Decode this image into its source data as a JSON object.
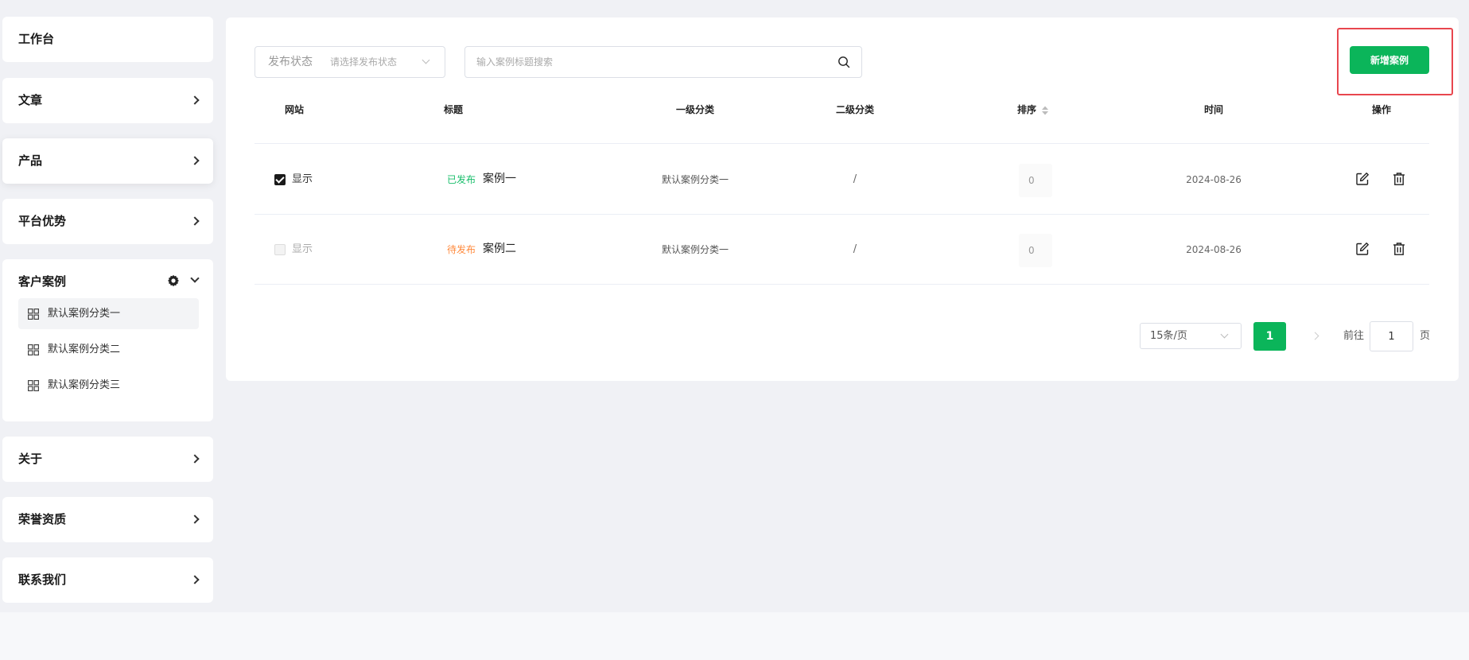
{
  "sidebar": {
    "items": [
      {
        "label": "工作台"
      },
      {
        "label": "文章"
      },
      {
        "label": "产品"
      },
      {
        "label": "平台优势"
      },
      {
        "label": "客户案例",
        "sub_items": [
          {
            "label": "默认案例分类一"
          },
          {
            "label": "默认案例分类二"
          },
          {
            "label": "默认案例分类三"
          }
        ]
      },
      {
        "label": "关于"
      },
      {
        "label": "荣誉资质"
      },
      {
        "label": "联系我们"
      }
    ]
  },
  "filters": {
    "status_label": "发布状态",
    "status_placeholder": "请选择发布状态",
    "search_placeholder": "输入案例标题搜索"
  },
  "toolbar": {
    "add_label": "新增案例"
  },
  "table": {
    "headers": [
      "网站",
      "标题",
      "一级分类",
      "二级分类",
      "排序",
      "时间",
      "操作"
    ],
    "rows": [
      {
        "site": "显示",
        "site_checked": true,
        "status": "已发布",
        "status_color": "#19be6b",
        "title": "案例一",
        "category1": "默认案例分类一",
        "category2": "/",
        "sort": "0",
        "date": "2024-08-26"
      },
      {
        "site": "显示",
        "site_checked": false,
        "status": "待发布",
        "status_color": "#ff8a3d",
        "title": "案例二",
        "category1": "默认案例分类一",
        "category2": "/",
        "sort": "0",
        "date": "2024-08-26"
      }
    ]
  },
  "pagination": {
    "page_size": "15条/页",
    "current_page": "1",
    "goto_prefix": "前往",
    "goto_value": "1",
    "goto_suffix": "页"
  },
  "colors": {
    "accent": "#0bb55a",
    "highlight": "#e8464e",
    "published": "#19be6b",
    "pending": "#ff8a3d"
  },
  "icons": [
    "chevron-right-icon",
    "gear-icon",
    "chevron-down-icon",
    "grid-icon",
    "search-icon",
    "sort-icon",
    "edit-icon",
    "delete-icon"
  ]
}
